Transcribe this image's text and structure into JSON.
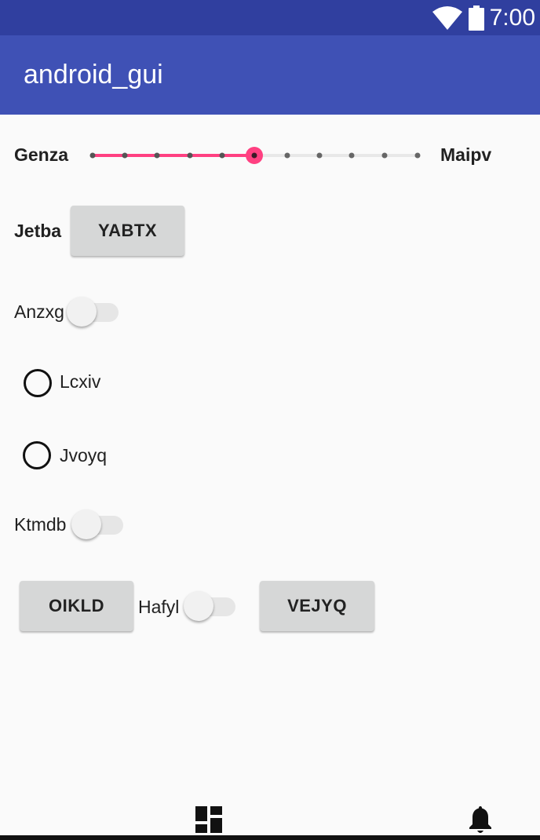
{
  "status_bar": {
    "time": "7:00",
    "icons": [
      "wifi-icon",
      "battery-icon"
    ]
  },
  "app_bar": {
    "title": "android_gui"
  },
  "slider": {
    "left_label": "Genza",
    "right_label": "Maipv",
    "steps": 10,
    "value": 5
  },
  "row_jetba": {
    "label": "Jetba",
    "button": "YABTX"
  },
  "switch_anzxg": {
    "label": "Anzxg",
    "checked": false
  },
  "radio_lcxiv": {
    "label": "Lcxiv",
    "checked": false
  },
  "radio_jvoyq": {
    "label": "Jvoyq",
    "checked": false
  },
  "switch_ktmdb": {
    "label": "Ktmdb",
    "checked": false
  },
  "row_bottom": {
    "button_left": "OIKLD",
    "switch_label": "Hafyl",
    "button_right": "VEJYQ"
  },
  "bottom_nav": {
    "icons": [
      "dashboard-icon",
      "notifications-icon"
    ]
  },
  "colors": {
    "primary": "#3f51b5",
    "primary_dark": "#303f9f",
    "accent": "#ff4081"
  }
}
